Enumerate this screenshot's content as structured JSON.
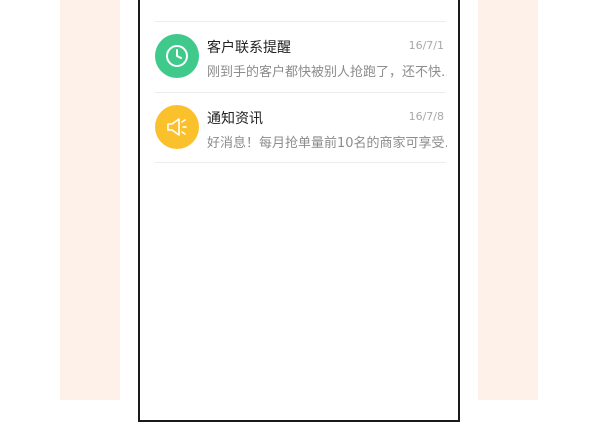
{
  "colors": {
    "background": "#ffffff",
    "side_panel": "#fdf1ea",
    "phone_border": "#1a1a1a",
    "partial_avatar": "#3cc4f0",
    "contact_reminder_avatar": "#3fc98b",
    "notification_avatar": "#fbc12d"
  },
  "messages": [
    {
      "title": "客户联系提醒",
      "date": "16/7/1",
      "preview": "刚到手的客户都快被别人抢跑了，还不快…",
      "icon": "clock-icon"
    },
    {
      "title": "通知资讯",
      "date": "16/7/8",
      "preview": "好消息！每月抢单量前10名的商家可享受…",
      "icon": "megaphone-icon"
    }
  ]
}
